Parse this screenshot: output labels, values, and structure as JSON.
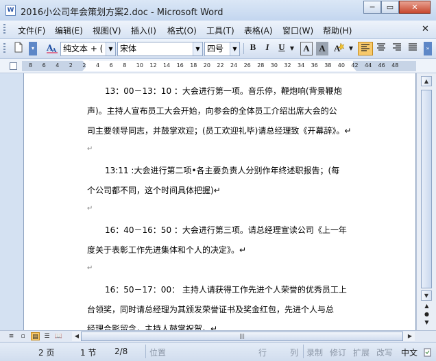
{
  "window": {
    "app_icon": "W",
    "title": "2016小公司年会策划方案2.doc - Microsoft Word",
    "min_glyph": "─",
    "max_glyph": "▭",
    "close_glyph": "✕"
  },
  "menu": {
    "items": [
      "文件(F)",
      "编辑(E)",
      "视图(V)",
      "插入(I)",
      "格式(O)",
      "工具(T)",
      "表格(A)",
      "窗口(W)",
      "帮助(H)"
    ],
    "close_glyph": "✕"
  },
  "toolbar": {
    "style_value": "纯文本 + (",
    "font_value": "宋体",
    "size_value": "四号",
    "bold": "B",
    "italic": "I",
    "underline": "U",
    "font_color": "A",
    "char_shading": "A"
  },
  "ruler": {
    "labels": [
      "8",
      "6",
      "4",
      "2",
      "2",
      "4",
      "6",
      "8",
      "10",
      "12",
      "14",
      "16",
      "18",
      "20",
      "22",
      "24",
      "26",
      "28",
      "30",
      "32",
      "34",
      "36",
      "38",
      "40",
      "42",
      "44",
      "46",
      "48"
    ]
  },
  "document": {
    "lines": [
      "13：00－13：10 ：大会进行第一项。音乐停，鞭炮响(背景鞭炮",
      "声)。主持人宣布员工大会开始，向参会的全体员工介绍出席大会的公",
      "司主要领导同志，并鼓掌欢迎；(员工欢迎礼毕)请总经理致《开幕辞》。↵",
      "↵",
      "13:11 :大会进行第二项•各主要负责人分别作年终述职报告；(每",
      "个公司都不同，这个时间具体把握)↵",
      "↵",
      "16：40－16：50 ：大会进行第三项。请总经理宣读公司《上一年",
      "度关于表彰工作先进集体和个人的决定》。↵",
      "↵",
      "16：50－17：00： 主持人请获得工作先进个人荣誉的优秀员工上",
      "台领奖，同时请总经理为其颁发荣誉证书及奖金红包，先进个人与总",
      "经理合影留念，主持人鼓掌祝贺。↵"
    ]
  },
  "scrollbar": {
    "up": "▲",
    "down": "▼",
    "prev": "▲",
    "select": "●",
    "next": "▼",
    "left": "◀",
    "right": "▶",
    "grip": "|||"
  },
  "status": {
    "page": "2 页",
    "section": "1 节",
    "page_of": "2/8",
    "position": "位置",
    "line": "行",
    "column": "列",
    "rec": "录制",
    "trk": "修订",
    "ext": "扩展",
    "ovr": "改写",
    "language": "中文"
  }
}
